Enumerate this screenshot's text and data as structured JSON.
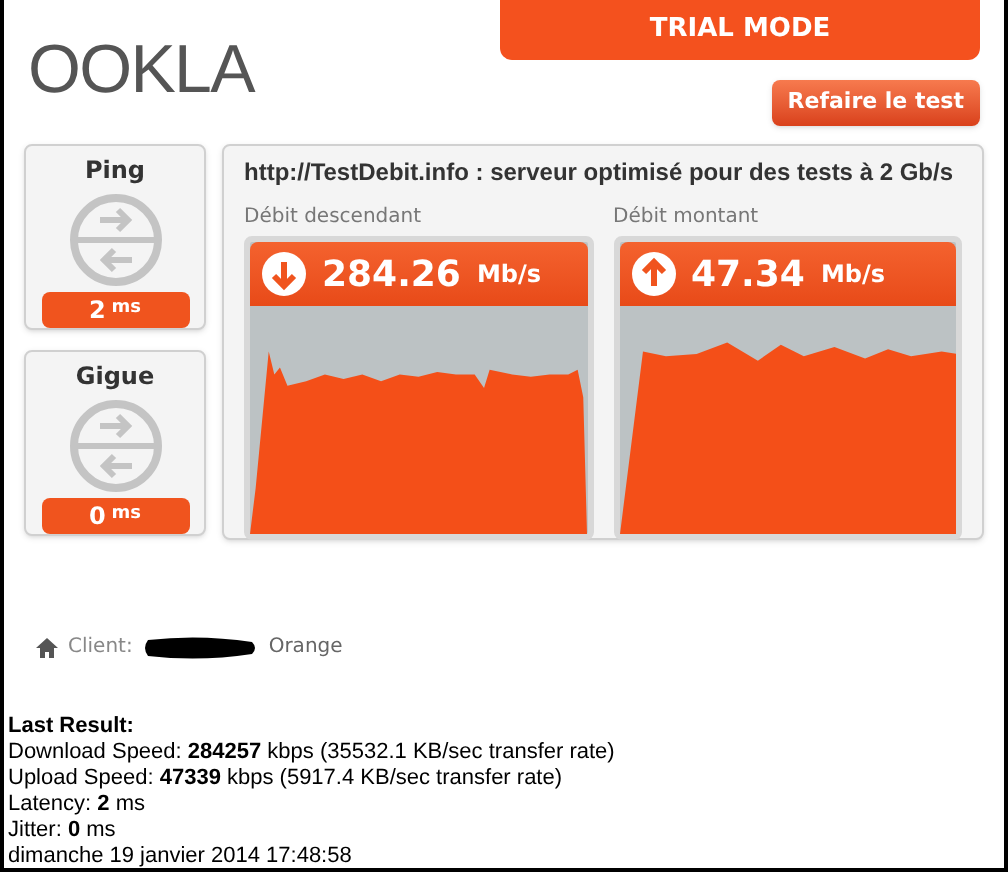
{
  "header": {
    "logo": "OOKLA",
    "banner": "TRIAL MODE",
    "button": "Refaire le test"
  },
  "metrics": [
    {
      "label": "Ping",
      "value": "2",
      "unit": "ms"
    },
    {
      "label": "Gigue",
      "value": "0",
      "unit": "ms"
    }
  ],
  "server": "http://TestDebit.info : serveur optimisé pour des tests à 2 Gb/s",
  "speeds": [
    {
      "label": "Débit descendant",
      "kind": "down",
      "value": "284.26",
      "unit": "Mb/s"
    },
    {
      "label": "Débit montant",
      "kind": "up",
      "value": "47.34",
      "unit": "Mb/s"
    }
  ],
  "client": {
    "label": "Client:",
    "isp": "Orange"
  },
  "last_result": {
    "title": "Last Result:",
    "lines": [
      "Download Speed: **284257** kbps (35532.1 KB/sec transfer rate)",
      "Upload Speed: **47339** kbps (5917.4 KB/sec transfer rate)",
      "Latency: **2** ms",
      "Jitter: **0** ms",
      "dimanche 19 janvier 2014 17:48:58"
    ]
  }
}
